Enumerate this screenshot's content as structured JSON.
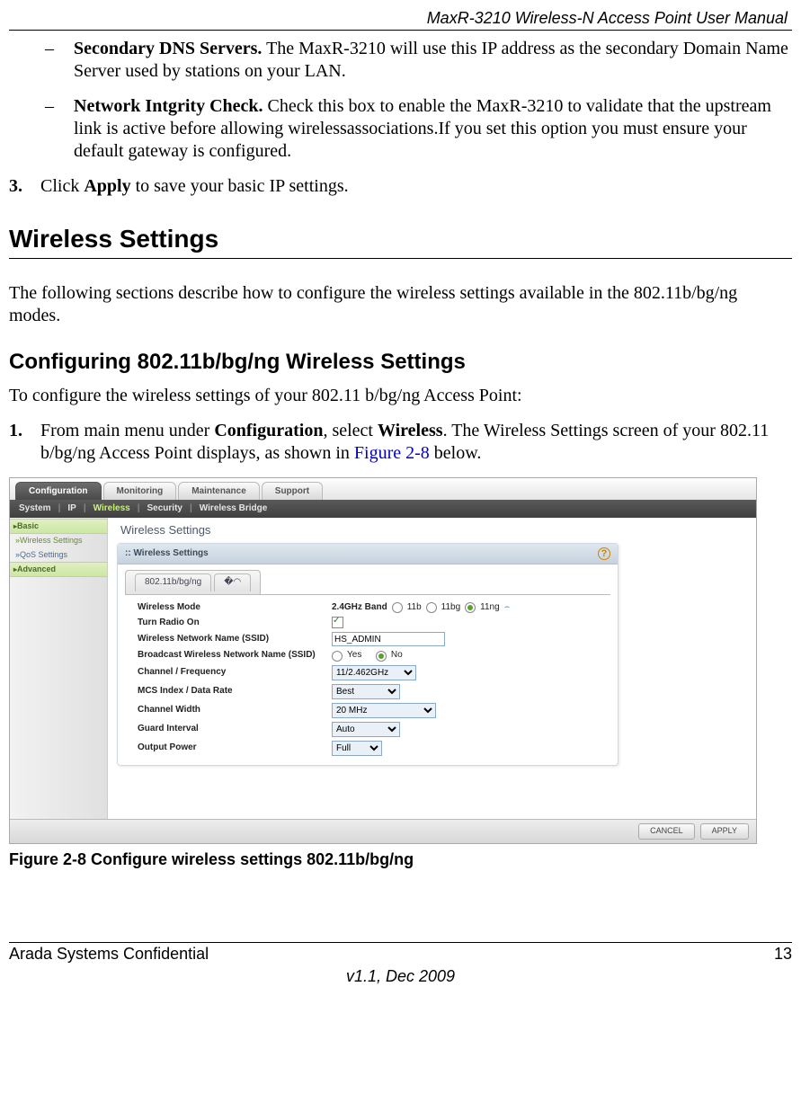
{
  "header": {
    "doc_title": "MaxR-3210 Wireless-N Access Point User Manual"
  },
  "bullets": {
    "dns": {
      "label": "Secondary DNS Servers.",
      "text": " The MaxR-3210 will use this IP address as the secondary Domain Name Server used by stations on your LAN."
    },
    "nic": {
      "label": "Network Intgrity Check.",
      "text": " Check this box to enable the MaxR-3210 to validate that the upstream link is active before allowing wirelessassociations.If you set this option you must ensure your default gateway is configured."
    }
  },
  "step3": {
    "num": "3.",
    "pre": "Click ",
    "bold": "Apply",
    "post": " to save your basic IP settings."
  },
  "section": {
    "title": "Wireless Settings"
  },
  "intro": "The following sections describe how to configure the wireless settings available in the 802.11b/bg/ng modes.",
  "subsection": {
    "title": "Configuring 802.11b/bg/ng Wireless Settings"
  },
  "sub_intro": "To configure the wireless settings of your 802.11 b/bg/ng Access Point:",
  "step1": {
    "num": "1.",
    "pre": "From main menu under ",
    "b1": "Configuration",
    "mid": ", select ",
    "b2": "Wireless",
    "post1": ". The Wireless Settings screen of your 802.11 b/bg/ng Access Point displays, as shown in ",
    "link": "Figure 2-8",
    "post2": " below."
  },
  "ui": {
    "tabs": {
      "configuration": "Configuration",
      "monitoring": "Monitoring",
      "maintenance": "Maintenance",
      "support": "Support"
    },
    "submenu": {
      "system": "System",
      "ip": "IP",
      "wireless": "Wireless",
      "security": "Security",
      "bridge": "Wireless Bridge"
    },
    "sidebar": {
      "basic": "Basic",
      "wireless_settings": "Wireless Settings",
      "qos": "QoS Settings",
      "advanced": "Advanced"
    },
    "panel_title": "Wireless Settings",
    "card_title": "Wireless Settings",
    "inner_tab": "802.11b/bg/ng",
    "fields": {
      "mode_label": "Wireless Mode",
      "mode_band": "2.4GHz Band",
      "mode_11b": "11b",
      "mode_11bg": "11bg",
      "mode_11ng": "11ng",
      "radio_label": "Turn Radio On",
      "ssid_label": "Wireless Network Name (SSID)",
      "ssid_value": "HS_ADMIN",
      "bcast_label": "Broadcast Wireless Network Name (SSID)",
      "bcast_yes": "Yes",
      "bcast_no": "No",
      "chan_label": "Channel / Frequency",
      "chan_value": "11/2.462GHz",
      "mcs_label": "MCS Index / Data Rate",
      "mcs_value": "Best",
      "cwidth_label": "Channel Width",
      "cwidth_value": "20 MHz",
      "guard_label": "Guard Interval",
      "guard_value": "Auto",
      "power_label": "Output Power",
      "power_value": "Full"
    },
    "buttons": {
      "cancel": "CANCEL",
      "apply": "APPLY"
    }
  },
  "fig_caption": "Figure 2-8  Configure wireless settings 802.11b/bg/ng",
  "footer": {
    "left": "Arada Systems Confidential",
    "right": "13",
    "version": "v1.1, Dec 2009"
  }
}
